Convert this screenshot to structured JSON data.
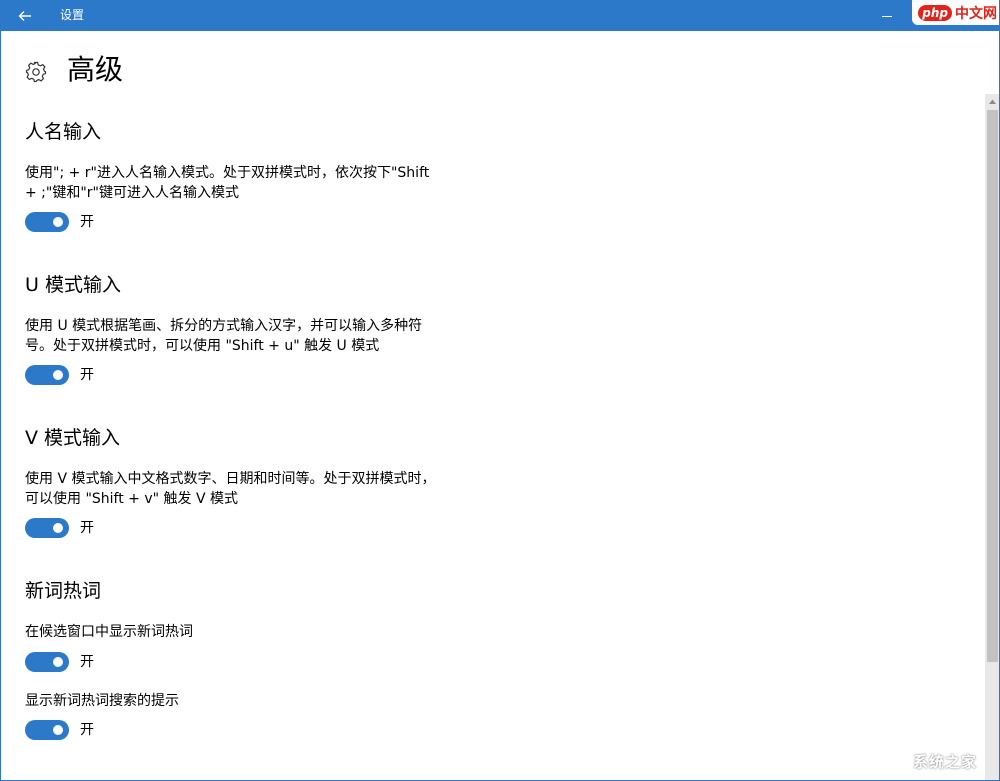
{
  "titlebar": {
    "app_title": "设置",
    "watermark_logo": "php中文网",
    "bg_color": "#2b79c8"
  },
  "page": {
    "title": "高级",
    "icon": "gear-icon"
  },
  "sections": [
    {
      "header": "人名输入",
      "description_lines": [
        "使用\"; + r\"进入人名输入模式。处于双拼模式时，依次按下\"Shift",
        "+ ;\"键和\"r\"键可进入人名输入模式"
      ],
      "toggle_state": "开"
    },
    {
      "header": "U 模式输入",
      "description_lines": [
        "使用 U 模式根据笔画、拆分的方式输入汉字，并可以输入多种符",
        "号。处于双拼模式时，可以使用 \"Shift + u\" 触发 U 模式"
      ],
      "toggle_state": "开"
    },
    {
      "header": "V 模式输入",
      "description_lines": [
        "使用 V 模式输入中文格式数字、日期和时间等。处于双拼模式时，",
        "可以使用 \"Shift + v\" 触发 V 模式"
      ],
      "toggle_state": "开"
    },
    {
      "header": "新词热词",
      "settings": [
        {
          "label": "在候选窗口中显示新词热词",
          "toggle_state": "开"
        },
        {
          "label": "显示新词热词搜索的提示",
          "toggle_state": "开"
        }
      ]
    }
  ],
  "footer_watermark": "系统之家",
  "colors": {
    "accent": "#2b79c8",
    "scroll_track": "#e8e8e8",
    "scroll_thumb": "#c2c2c2"
  }
}
